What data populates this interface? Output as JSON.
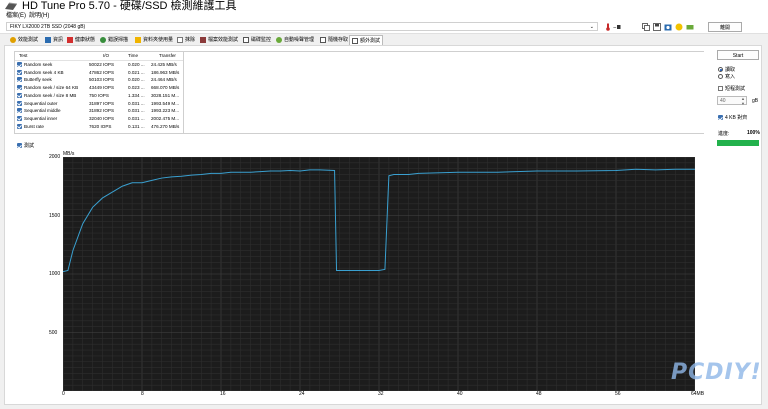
{
  "window": {
    "title": "HD Tune Pro 5.70 - 硬碟/SSD 檢測維護工具"
  },
  "menu": [
    "檔案(E)",
    "說明(H)"
  ],
  "drive": {
    "selected": "FIKY LX2000 2TB SSD (2048 gB)"
  },
  "toolbar": {
    "exit_label": "離開",
    "icons": [
      "thermometer-icon",
      "health-icon",
      "copy-icon",
      "save-icon",
      "camera-icon",
      "favorite-icon",
      "disk-icon"
    ]
  },
  "tabs": [
    "效能測試",
    "資訊",
    "健康狀態",
    "錯誤掃描",
    "資料夾使用量",
    "抹除",
    "檔案效能測試",
    "磁碟監控",
    "自動噪聲管理",
    "隨機存取",
    "額外測試"
  ],
  "active_tab": "額外測試",
  "results": {
    "headers": {
      "test": "Test",
      "io": "I/O",
      "time": "Time",
      "transfer": "Transfer"
    },
    "rows": [
      {
        "test": "Random seek",
        "io": "50022 IOPS",
        "time": "0.020 ...",
        "transfer": "24.425 MB/s"
      },
      {
        "test": "Random seek 4 KB",
        "io": "47862 IOPS",
        "time": "0.021 ...",
        "transfer": "186.963 MB/s"
      },
      {
        "test": "Butterfly seek",
        "io": "50103 IOPS",
        "time": "0.020 ...",
        "transfer": "24.464 MB/s"
      },
      {
        "test": "Random seek / size 64 KB",
        "io": "43449 IOPS",
        "time": "0.023 ...",
        "transfer": "668.070 MB/s"
      },
      {
        "test": "Random seek / size 8 MB",
        "io": "750 IOPS",
        "time": "1.334 ...",
        "transfer": "3028.151 M..."
      },
      {
        "test": "Sequential outer",
        "io": "31897 IOPS",
        "time": "0.031 ...",
        "transfer": "1993.549 M..."
      },
      {
        "test": "Sequential middle",
        "io": "31892 IOPS",
        "time": "0.031 ...",
        "transfer": "1993.223 M..."
      },
      {
        "test": "Sequential inner",
        "io": "32040 IOPS",
        "time": "0.031 ...",
        "transfer": "2002.475 M..."
      },
      {
        "test": "Burst rate",
        "io": "7620 IOPS",
        "time": "0.131 ...",
        "transfer": "476.270 MB/s"
      }
    ]
  },
  "right_panel": {
    "start_label": "Start",
    "read_label": "讀取",
    "write_label": "寫入",
    "short_test_label": "短程測試",
    "short_test_value": "40",
    "short_test_unit": "gB",
    "align_label": "4 KB 對齊",
    "progress_label": "進度:",
    "progress_value": "100%",
    "progress_fraction": 1.0
  },
  "chart_toggle_label": "測試",
  "chart_data": {
    "type": "line",
    "ylabel": "MB/s",
    "xlabel": "",
    "x_unit_label": "64MB",
    "ylim": [
      0,
      2000
    ],
    "xlim": [
      0,
      64
    ],
    "yticks": [
      500,
      1000,
      1500,
      2000
    ],
    "xticks": [
      0,
      8,
      16,
      24,
      32,
      40,
      48,
      56
    ],
    "grid": true,
    "series": [
      {
        "color": "#3aa0d0",
        "x": [
          0,
          0.5,
          1,
          2,
          3,
          4,
          5,
          6,
          7,
          8,
          9,
          10,
          11,
          12,
          13,
          14,
          15,
          16,
          17,
          18,
          19,
          20,
          21,
          22,
          23,
          24,
          25,
          26,
          27.5,
          27.7,
          30,
          32,
          32.6,
          33,
          33.5,
          34,
          35,
          36,
          40,
          44,
          48,
          52,
          56,
          58,
          60,
          62,
          64
        ],
        "y": [
          1020,
          1030,
          1200,
          1430,
          1570,
          1650,
          1700,
          1750,
          1780,
          1780,
          1800,
          1820,
          1830,
          1835,
          1845,
          1850,
          1860,
          1860,
          1870,
          1870,
          1870,
          1875,
          1880,
          1880,
          1885,
          1880,
          1890,
          1890,
          1885,
          1030,
          1030,
          1030,
          1040,
          1840,
          1850,
          1850,
          1850,
          1860,
          1870,
          1870,
          1880,
          1880,
          1885,
          1895,
          1890,
          1895,
          1895
        ]
      }
    ]
  }
}
